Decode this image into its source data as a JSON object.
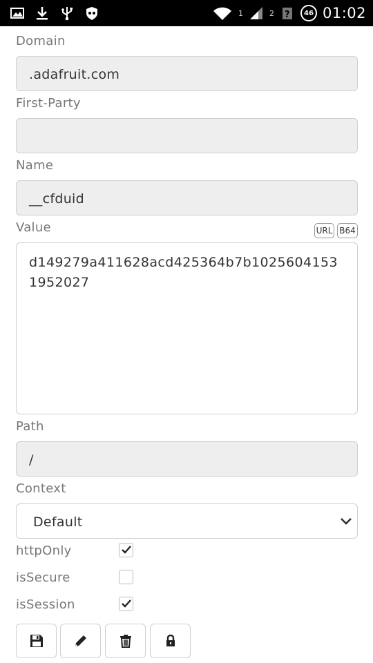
{
  "status_bar": {
    "time": "01:02",
    "battery_level": "46",
    "sim_label": "2",
    "wifi_label": "1",
    "icons": [
      "image-icon",
      "download-icon",
      "usb-icon",
      "shield-icon",
      "wifi-icon",
      "signal-icon",
      "battery-icon"
    ]
  },
  "form": {
    "domain": {
      "label": "Domain",
      "value": ".adafruit.com"
    },
    "first_party": {
      "label": "First-Party",
      "value": ""
    },
    "name": {
      "label": "Name",
      "value": "__cfduid"
    },
    "value": {
      "label": "Value",
      "url_button": "URL",
      "b64_button": "B64",
      "text": "d149279a411628acd425364b7b1025604153 1952027"
    },
    "path": {
      "label": "Path",
      "value": "/"
    },
    "context": {
      "label": "Context",
      "selected": "Default"
    },
    "flags": [
      {
        "label": "httpOnly",
        "checked": true
      },
      {
        "label": "isSecure",
        "checked": false
      },
      {
        "label": "isSession",
        "checked": true
      }
    ]
  },
  "actions": [
    "save-icon",
    "edit-icon",
    "delete-icon",
    "lock-icon"
  ]
}
